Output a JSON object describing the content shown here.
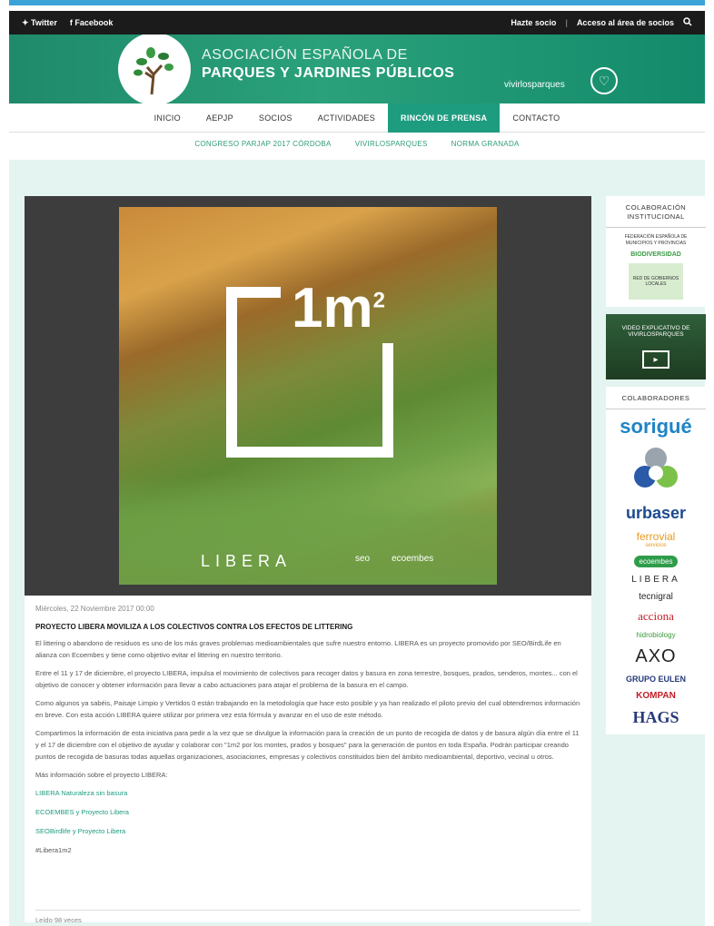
{
  "topbar": {
    "twitter": "Twitter",
    "facebook": "Facebook",
    "join": "Hazte socio",
    "members": "Acceso al área de socios"
  },
  "header": {
    "title_line1": "ASOCIACIÓN ESPAÑOLA DE",
    "title_line2": "PARQUES Y JARDINES PÚBLICOS",
    "brand": "vivirlosparques"
  },
  "mainnav": {
    "items": [
      {
        "label": "INICIO"
      },
      {
        "label": "AEPJP"
      },
      {
        "label": "SOCIOS"
      },
      {
        "label": "ACTIVIDADES"
      },
      {
        "label": "RINCÓN DE PRENSA"
      },
      {
        "label": "CONTACTO"
      }
    ],
    "active_index": 4
  },
  "subnav": {
    "items": [
      {
        "label": "CONGRESO PARJAP 2017 CÓRDOBA"
      },
      {
        "label": "VIVIRLOSPARQUES"
      },
      {
        "label": "NORMA GRANADA"
      }
    ]
  },
  "article": {
    "image_text": "1m",
    "image_sup": "2",
    "image_libera": "LIBERA",
    "image_logo1": "seo",
    "image_logo2": "ecoembes",
    "date": "Miércoles, 22 Noviembre 2017 00:00",
    "title": "PROYECTO LIBERA MOVILIZA A LOS COLECTIVOS CONTRA LOS EFECTOS DE LITTERING",
    "p1": "El littering o abandono de residuos es uno de los más graves problemas medioambientales que sufre nuestro entorno. LIBERA es un proyecto promovido por SEO/BirdLife en alianza con Ecoembes y tiene como objetivo evitar el littering en nuestro territorio.",
    "p2": "Entre el 11 y 17 de diciembre, el proyecto LIBERA, impulsa el movimiento de colectivos para recoger datos y basura en zona terrestre, bosques, prados, senderos, montes... con el objetivo de conocer y obtener información para llevar a cabo actuaciones para atajar el problema de la basura en el campo.",
    "p3": "Como algunos ya sabéis, Paisaje Limpio y Vertidos 0 están trabajando en la metodología que hace esto posible y ya han realizado el piloto previo del cual obtendremos información en breve. Con esta acción LIBERA quiere utilizar por primera vez esta fórmula y avanzar en el uso de este método.",
    "p4": "Compartimos la información de esta iniciativa para pedir a la vez que se divulgue la información para la creación de un punto de recogida de datos y de basura algún día entre el 11 y el 17 de diciembre con el objetivo de ayudar y colaborar con \"1m2 por los montes, prados y bosques\" para la generación de puntos en toda España. Podrán participar creando puntos de recogida de basuras todas aquellas organizaciones, asociaciones, empresas y colectivos constituidos bien del ámbito medioambiental, deportivo, vecinal u otros.",
    "more_info": "Más información sobre el proyecto LIBERA:",
    "links": [
      {
        "label": "LIBERA Naturaleza sin basura"
      },
      {
        "label": "ECOEMBES y Proyecto Libera"
      },
      {
        "label": "SEOBirdlife y Proyecto Libera"
      }
    ],
    "hashtag": "#Libera1m2",
    "reads": "Leído 98 veces"
  },
  "sidebar": {
    "institutional_title": "COLABORACIÓN INSTITUCIONAL",
    "institutional_logos": [
      "FEDERACIÓN ESPAÑOLA DE MUNICIPIOS Y PROVINCIAS",
      "BIODIVERSIDAD",
      "RED DE GOBIERNOS LOCALES"
    ],
    "video_title": "VIDEO EXPLICATIVO DE VIVIRLOSPARQUES",
    "collab_title": "COLABORADORES",
    "collaborators": {
      "sorigue": "sorigué",
      "urbaser": "urbaser",
      "ferrovial": "ferrovial",
      "ferrovial_sub": "servicios",
      "ecoembes": "ecoembes",
      "libera": "LIBERA",
      "tecnigral": "tecnigral",
      "acciona": "acciona",
      "hidrobiology": "hidrobiology",
      "axo": "AXO",
      "eulen": "GRUPO EULEN",
      "kompan": "KOMPAN",
      "hags": "HAGS"
    }
  },
  "colors": {
    "accent": "#1e9c80",
    "topbar": "#1b1b1b",
    "content_bg": "#e4f4f0"
  }
}
